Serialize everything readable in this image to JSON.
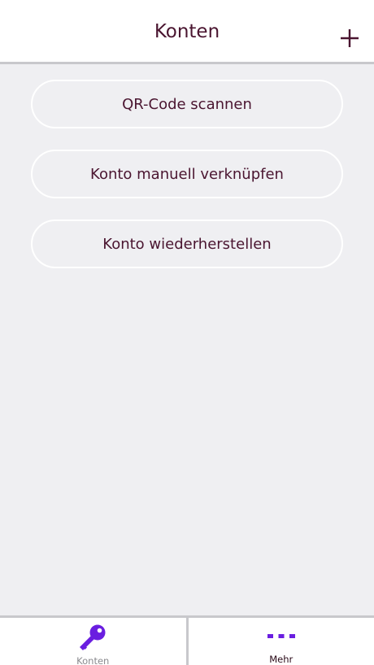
{
  "header": {
    "title": "Konten",
    "add_icon": "plus-icon"
  },
  "actions": [
    {
      "label": "QR-Code scannen"
    },
    {
      "label": "Konto manuell verknüpfen"
    },
    {
      "label": "Konto wiederherstellen"
    }
  ],
  "tabbar": {
    "tabs": [
      {
        "label": "Konten",
        "icon": "key-icon",
        "selected": false
      },
      {
        "label": "Mehr",
        "icon": "more-dots-icon",
        "selected": true
      }
    ]
  },
  "colors": {
    "accent": "#6a1ee0",
    "text": "#4a1530",
    "background": "#efeff2"
  }
}
